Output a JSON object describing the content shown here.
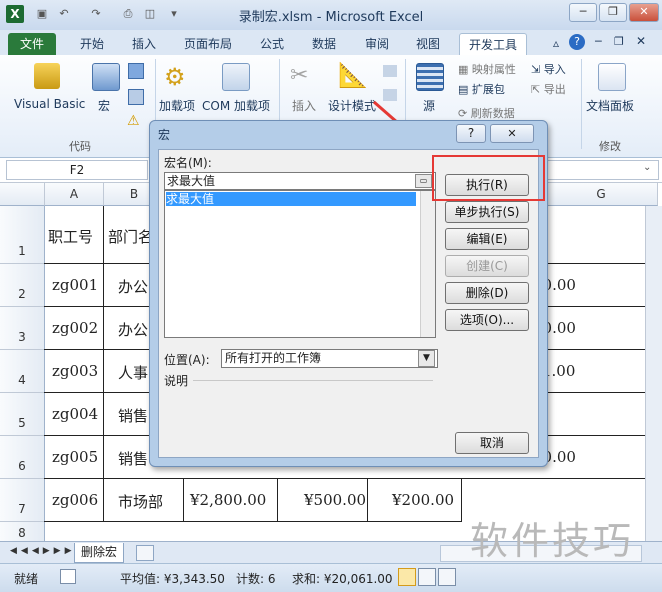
{
  "window": {
    "title": "录制宏.xlsm  -  Microsoft Excel",
    "app_icon": "X",
    "qat_icons": [
      "save-icon",
      "undo-icon",
      "redo-icon",
      "print-icon",
      "print-preview-icon"
    ],
    "controls": [
      "minimize-icon",
      "restore-icon",
      "close-icon"
    ]
  },
  "ribbon": {
    "tabs": [
      "文件",
      "开始",
      "插入",
      "页面布局",
      "公式",
      "数据",
      "审阅",
      "视图",
      "开发工具"
    ],
    "active_tab": "开发工具",
    "code_group": {
      "visual_basic": "Visual Basic",
      "macros": "宏",
      "label": "代码"
    },
    "addins_group": {
      "addins": "加载项",
      "com_addins": "COM 加载项"
    },
    "controls_group": {
      "insert": "插入",
      "design_mode": "设计模式"
    },
    "xml_group": {
      "source": "源",
      "map_properties": "映射属性",
      "expansion_packs": "扩展包",
      "refresh_data": "刷新数据",
      "import": "导入",
      "export": "导出"
    },
    "modify_group": {
      "document_panel": "文档面板",
      "label": "修改"
    }
  },
  "formula_bar": {
    "name_box": "F2"
  },
  "sheet": {
    "columns": [
      "A",
      "B",
      "G"
    ],
    "rows": [
      "1",
      "2",
      "3",
      "4",
      "5",
      "6",
      "7",
      "8"
    ],
    "header_cells": [
      "职工号",
      "部门名"
    ],
    "ids": [
      "zg001",
      "zg002",
      "zg003",
      "zg004",
      "zg005",
      "zg006"
    ],
    "depts": [
      "办公",
      "办公",
      "人事",
      "销售",
      "销售",
      "市场部"
    ],
    "right_values": [
      "00.00",
      "50.00",
      "1.00",
      "",
      "00.00"
    ],
    "row7": {
      "c": "¥2,800.00",
      "d": "¥500.00",
      "e": "¥200.00"
    }
  },
  "sheet_tabs": {
    "active": "删除宏"
  },
  "status": {
    "ready": "就绪",
    "average": "平均值: ¥3,343.50",
    "count": "计数: 6",
    "sum": "求和: ¥20,061.00"
  },
  "dialog": {
    "title": "宏",
    "macro_name_label": "宏名(M):",
    "macro_name_value": "求最大值",
    "list_items": [
      "求最大值"
    ],
    "buttons": {
      "run": "执行(R)",
      "step_into": "单步执行(S)",
      "edit": "编辑(E)",
      "create": "创建(C)",
      "delete": "删除(D)",
      "options": "选项(O)...",
      "cancel": "取消"
    },
    "location_label": "位置(A):",
    "location_value": "所有打开的工作簿",
    "description_label": "说明",
    "help": "?",
    "close": "✕"
  },
  "watermark": "软件技巧",
  "colors": {
    "file_tab": "#2a7a3b",
    "highlight": "#e53935",
    "selection": "#3399ff"
  }
}
